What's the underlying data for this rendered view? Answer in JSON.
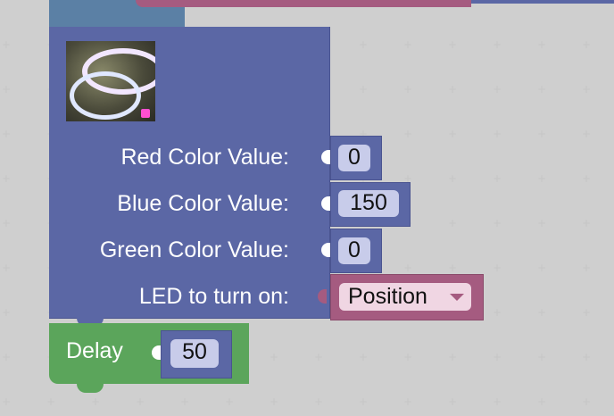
{
  "image": {
    "name": "LED strip"
  },
  "rgb_block": {
    "fields": [
      {
        "label": "Red Color Value:",
        "value": "0"
      },
      {
        "label": "Blue Color Value:",
        "value": "150"
      },
      {
        "label": "Green Color Value:",
        "value": "0"
      }
    ],
    "led_label": "LED to turn on:",
    "led_dropdown": "Position"
  },
  "delay_block": {
    "label": "Delay",
    "value": "50"
  },
  "colors": {
    "rgb_block": "#5b67a5",
    "dropdown_block": "#a55b80",
    "delay_block": "#5ba55b",
    "top_block": "#5b80a5"
  }
}
